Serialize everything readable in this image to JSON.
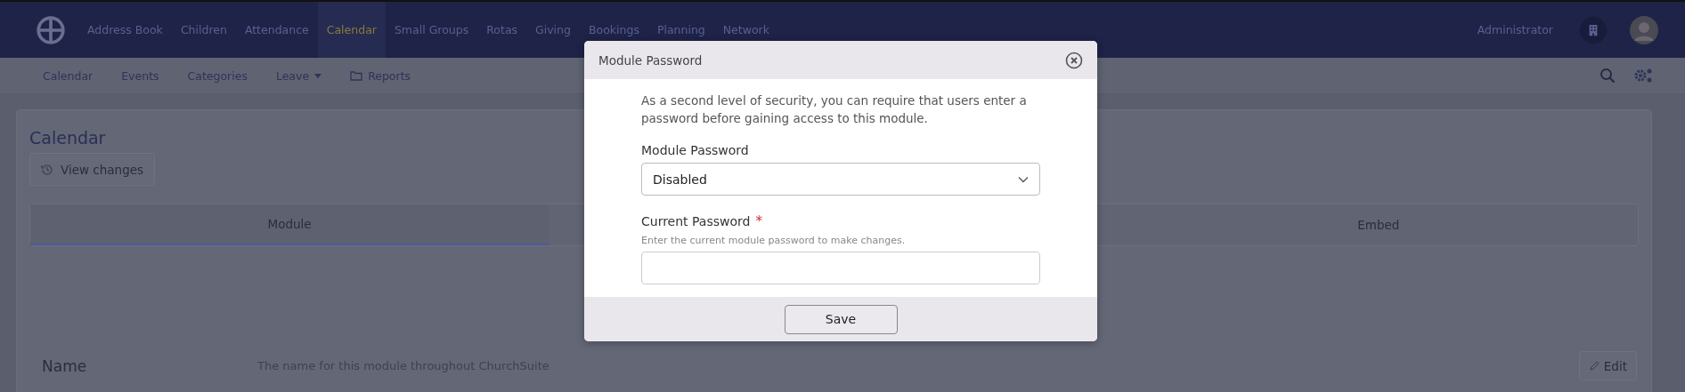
{
  "top_nav": {
    "items": [
      {
        "label": "Address Book",
        "selected": false
      },
      {
        "label": "Children",
        "selected": false
      },
      {
        "label": "Attendance",
        "selected": false
      },
      {
        "label": "Calendar",
        "selected": true
      },
      {
        "label": "Small Groups",
        "selected": false
      },
      {
        "label": "Rotas",
        "selected": false
      },
      {
        "label": "Giving",
        "selected": false
      },
      {
        "label": "Bookings",
        "selected": false
      },
      {
        "label": "Planning",
        "selected": false
      },
      {
        "label": "Network",
        "selected": false
      }
    ],
    "user": "Administrator"
  },
  "sub_nav": {
    "items": [
      {
        "label": "Calendar",
        "kind": "link"
      },
      {
        "label": "Events",
        "kind": "link"
      },
      {
        "label": "Categories",
        "kind": "link"
      },
      {
        "label": "Leave",
        "kind": "dropdown"
      },
      {
        "label": "Reports",
        "kind": "folder"
      }
    ]
  },
  "page": {
    "title": "Calendar",
    "view_changes": "View changes",
    "tabs": [
      {
        "label": "Module",
        "selected": true
      },
      {
        "label": "Embed",
        "selected": false
      }
    ],
    "rows": [
      {
        "label": "Name",
        "description": "The name for this module throughout ChurchSuite",
        "action": "Edit"
      }
    ]
  },
  "modal": {
    "title": "Module Password",
    "intro": "As a second level of security, you can require that users enter a password before gaining access to this module.",
    "select_label": "Module Password",
    "select_value": "Disabled",
    "password_label": "Current Password",
    "required_mark": "*",
    "password_help": "Enter the current module password to make changes.",
    "save": "Save"
  }
}
